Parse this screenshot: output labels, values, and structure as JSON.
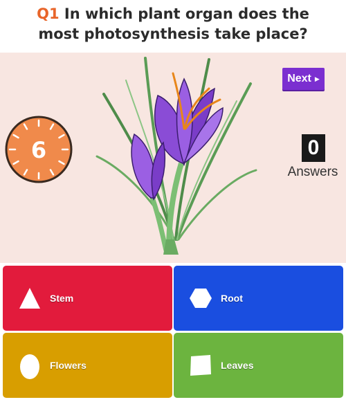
{
  "question": {
    "number": "Q1",
    "line1": "In which plant organ does the",
    "line2": "most photosynthesis take place?"
  },
  "timer": {
    "value": "6"
  },
  "next_button": {
    "label": "Next"
  },
  "answers": {
    "count": "0",
    "label": "Answers"
  },
  "image": {
    "subject": "crocus-flower"
  },
  "options": [
    {
      "label": "Stem",
      "shape": "triangle-icon",
      "color": "#e21b3c"
    },
    {
      "label": "Root",
      "shape": "hexagon-icon",
      "color": "#1a4ee0"
    },
    {
      "label": "Flowers",
      "shape": "circle-icon",
      "color": "#d89e00"
    },
    {
      "label": "Leaves",
      "shape": "square-icon",
      "color": "#6cb43f"
    }
  ],
  "colors": {
    "accent": "#e8652a",
    "next": "#7b2fd0",
    "stage_bg": "#f8e6e1"
  }
}
